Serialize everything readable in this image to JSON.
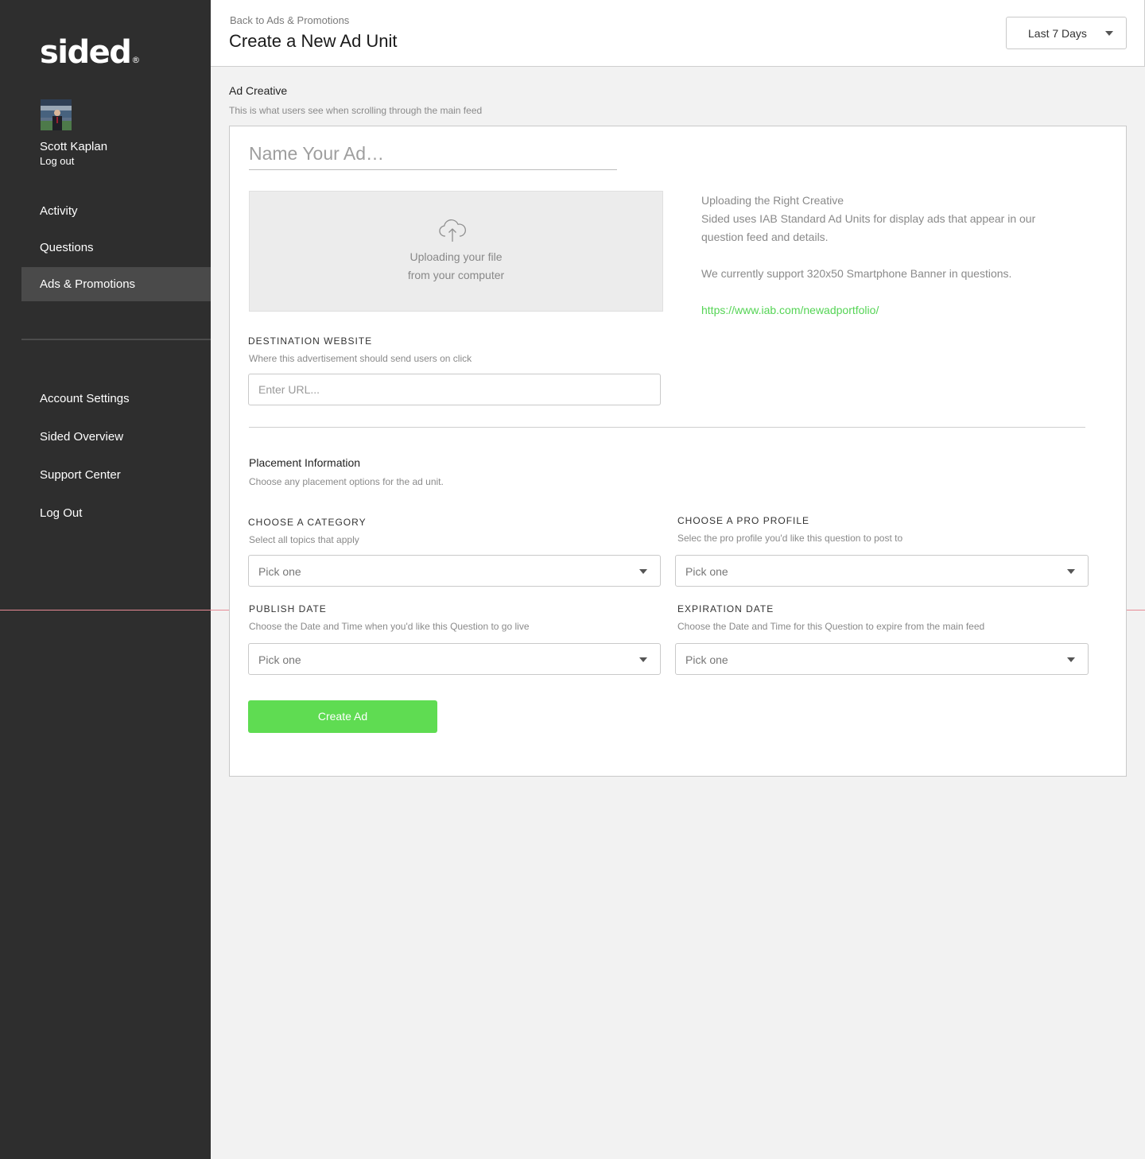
{
  "sidebar": {
    "logo": "sided",
    "logo_mark": "®",
    "user": {
      "name": "Scott Kaplan",
      "logout": "Log out"
    },
    "primary_nav": [
      {
        "label": "Activity",
        "active": false
      },
      {
        "label": "Questions",
        "active": false
      },
      {
        "label": "Ads & Promotions",
        "active": true
      }
    ],
    "secondary_nav": [
      {
        "label": "Account Settings"
      },
      {
        "label": "Sided Overview"
      },
      {
        "label": "Support Center"
      },
      {
        "label": "Log Out"
      }
    ]
  },
  "header": {
    "back_link": "Back to Ads & Promotions",
    "title": "Create a New Ad Unit",
    "date_range": {
      "value": "Last 7 Days",
      "icon": "caret-down-icon"
    }
  },
  "ad_creative": {
    "title": "Ad Creative",
    "subtitle": "This is what users see when scrolling through the main feed",
    "name_placeholder": "Name Your Ad…",
    "upload": {
      "icon": "cloud-upload-icon",
      "line1": "Uploading your file",
      "line2": "from your computer"
    },
    "info": {
      "heading": "Uploading the Right Creative",
      "body": "Sided uses IAB Standard Ad Units for display ads that appear in our question feed and details.",
      "support": "We currently support 320x50 Smartphone Banner in questions.",
      "link": "https://www.iab.com/newadportfolio/"
    },
    "destination": {
      "label": "DESTINATION WEBSITE",
      "hint": "Where this advertisement should send users on click",
      "placeholder": "Enter URL..."
    }
  },
  "placement": {
    "title": "Placement Information",
    "subtitle": "Choose any placement options for the ad unit.",
    "category": {
      "label": "CHOOSE A CATEGORY",
      "hint": "Select all topics that apply",
      "value": "Pick one"
    },
    "pro_profile": {
      "label": "CHOOSE A PRO PROFILE",
      "hint": "Selec the pro profile you'd like this question to post to",
      "value": "Pick one"
    },
    "publish_date": {
      "label": "PUBLISH DATE",
      "hint": "Choose the Date and Time when you'd like this Question to go live",
      "value": "Pick one"
    },
    "expiration_date": {
      "label": "EXPIRATION DATE",
      "hint": "Choose the Date and Time for this Question to expire from the main feed",
      "value": "Pick one"
    }
  },
  "actions": {
    "create": "Create Ad"
  },
  "colors": {
    "sidebar_bg": "#2e2e2e",
    "sidebar_active": "#4a4a4a",
    "accent_green": "#5fdc52",
    "link_green": "#55d455",
    "page_bg": "#f2f2f2"
  }
}
